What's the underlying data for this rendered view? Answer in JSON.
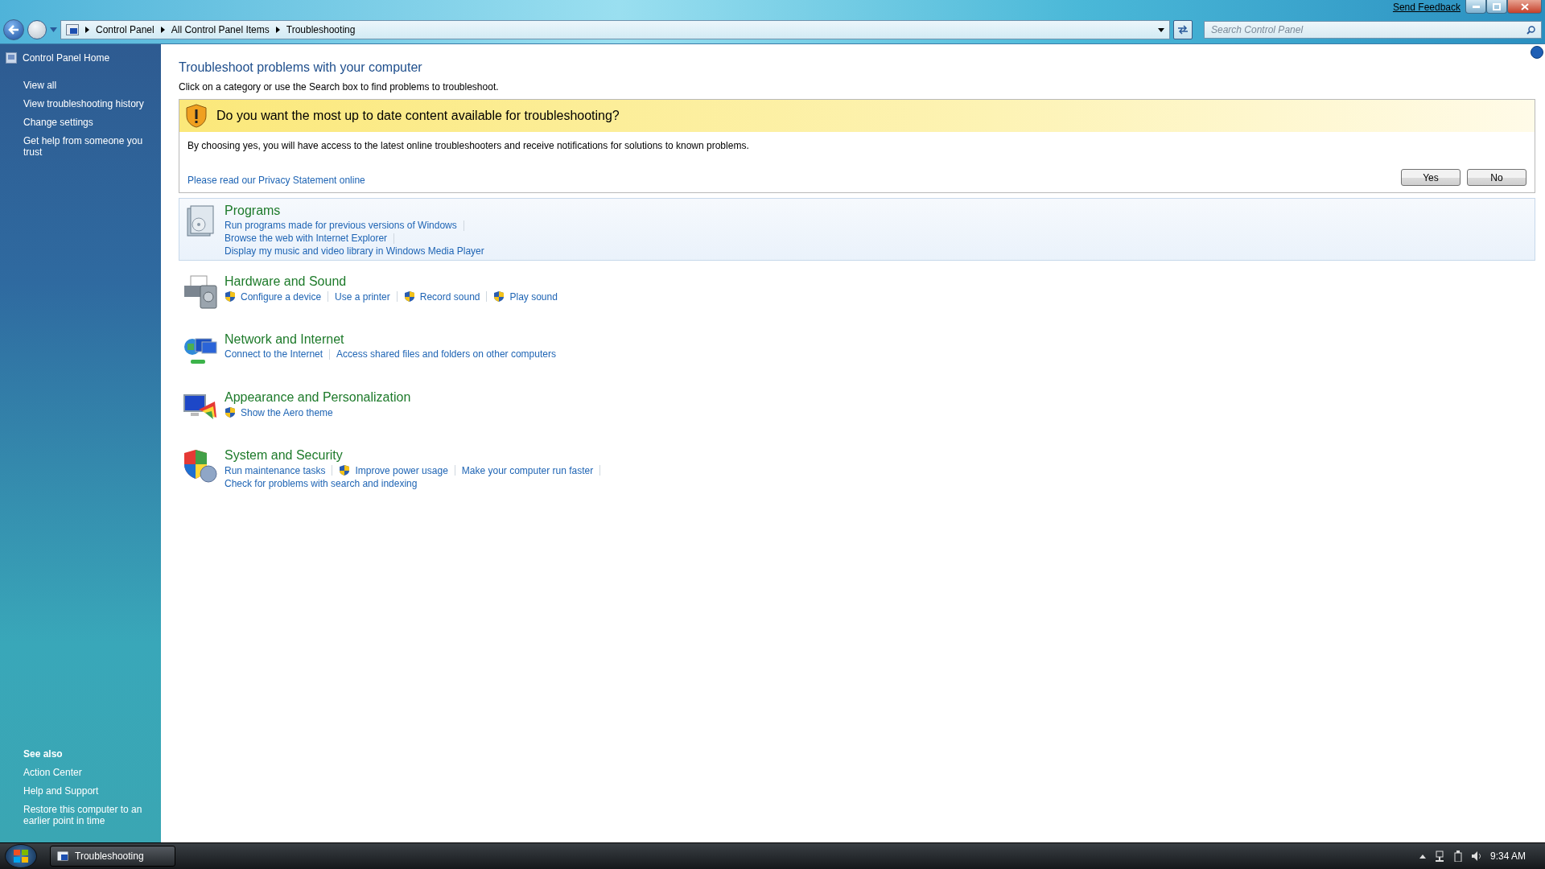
{
  "window": {
    "send_feedback": "Send Feedback"
  },
  "address_bar": {
    "crumbs": [
      "Control Panel",
      "All Control Panel Items",
      "Troubleshooting"
    ]
  },
  "search": {
    "placeholder": "Search Control Panel"
  },
  "sidebar": {
    "home": "Control Panel Home",
    "items": [
      "View all",
      "View troubleshooting history",
      "Change settings",
      "Get help from someone you trust"
    ],
    "see_also_title": "See also",
    "see_also": [
      "Action Center",
      "Help and Support",
      "Restore this computer to an earlier point in time"
    ]
  },
  "main": {
    "title": "Troubleshoot problems with your computer",
    "subtitle": "Click on a category or use the Search box to find problems to troubleshoot."
  },
  "banner": {
    "question": "Do you want the most up to date content available for troubleshooting?",
    "body": "By choosing yes, you will have access to the latest online troubleshooters and receive notifications for solutions to known problems.",
    "link": "Please read our Privacy Statement online",
    "buttons": [
      "Yes",
      "No"
    ]
  },
  "categories": [
    {
      "kind": "programs",
      "title": "Programs",
      "selected": true,
      "lines": [
        [
          {
            "text": "Run programs made for previous versions of Windows",
            "shield": false
          }
        ],
        [
          {
            "text": "Browse the web with Internet Explorer",
            "shield": false
          }
        ],
        [
          {
            "text": "Display my music and video library in Windows Media Player",
            "shield": false
          }
        ]
      ]
    },
    {
      "kind": "hardware",
      "title": "Hardware and Sound",
      "selected": false,
      "lines": [
        [
          {
            "text": "Configure a device",
            "shield": true
          },
          {
            "text": "Use a printer",
            "shield": false
          },
          {
            "text": "Record sound",
            "shield": true
          },
          {
            "text": "Play sound",
            "shield": true
          }
        ]
      ]
    },
    {
      "kind": "network",
      "title": "Network and Internet",
      "selected": false,
      "lines": [
        [
          {
            "text": "Connect to the Internet",
            "shield": false
          },
          {
            "text": "Access shared files and folders on other computers",
            "shield": false
          }
        ]
      ]
    },
    {
      "kind": "appearance",
      "title": "Appearance and Personalization",
      "selected": false,
      "lines": [
        [
          {
            "text": "Show the Aero theme",
            "shield": true
          }
        ]
      ]
    },
    {
      "kind": "security",
      "title": "System and Security",
      "selected": false,
      "lines": [
        [
          {
            "text": "Run maintenance tasks",
            "shield": false
          },
          {
            "text": "Improve power usage",
            "shield": true
          },
          {
            "text": "Make your computer run faster",
            "shield": false
          }
        ],
        [
          {
            "text": "Check for problems with search and indexing",
            "shield": false
          }
        ]
      ]
    }
  ],
  "taskbar": {
    "window_button": "Troubleshooting",
    "clock": "9:34 AM"
  }
}
